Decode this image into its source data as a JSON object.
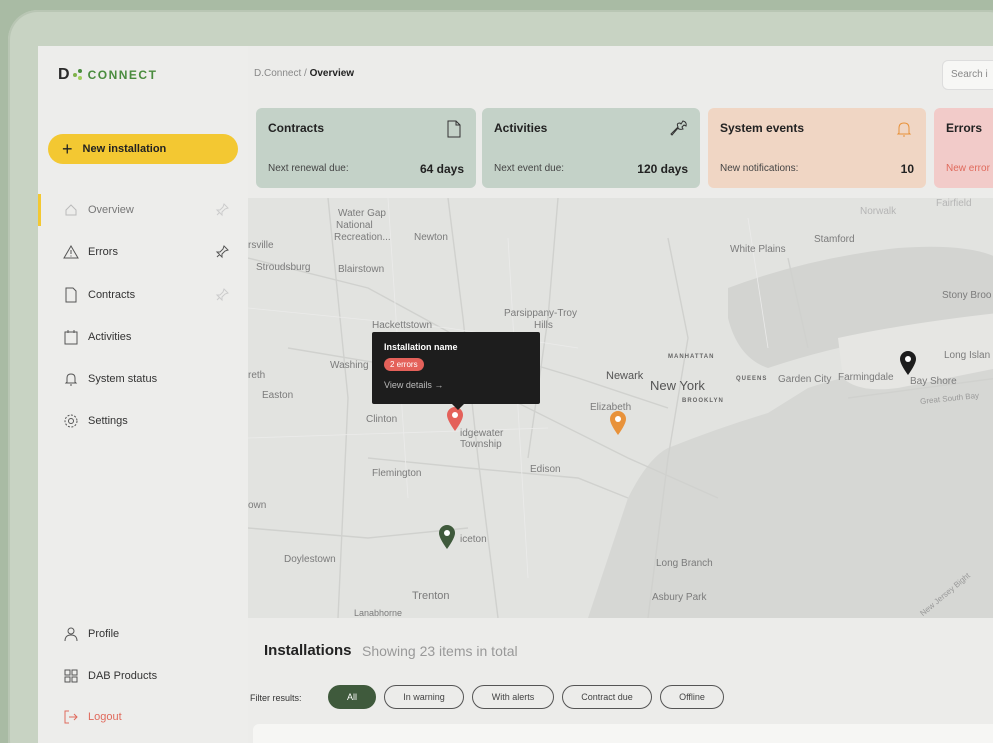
{
  "logo": {
    "d": "D",
    "text": "CONNECT"
  },
  "breadcrumb": {
    "root": "D.Connect",
    "sep": "/",
    "current": "Overview"
  },
  "search": {
    "placeholder": "Search i"
  },
  "sidebar": {
    "new_button": "New installation",
    "items": [
      {
        "label": "Overview",
        "icon": "home-icon",
        "active": true
      },
      {
        "label": "Errors",
        "icon": "warning-icon"
      },
      {
        "label": "Contracts",
        "icon": "document-icon"
      },
      {
        "label": "Activities",
        "icon": "calendar-icon"
      },
      {
        "label": "System status",
        "icon": "bell-icon"
      },
      {
        "label": "Settings",
        "icon": "gear-icon"
      }
    ],
    "bottom": [
      {
        "label": "Profile",
        "icon": "user-icon"
      },
      {
        "label": "DAB Products",
        "icon": "grid-icon"
      },
      {
        "label": "Logout",
        "icon": "logout-icon"
      }
    ]
  },
  "cards": [
    {
      "title": "Contracts",
      "sub": "Next renewal due:",
      "value": "64 days",
      "icon": "document-icon",
      "color": "#c4d2c8"
    },
    {
      "title": "Activities",
      "sub": "Next event due:",
      "value": "120 days",
      "icon": "wrench-icon",
      "color": "#c4d2c8"
    },
    {
      "title": "System events",
      "sub": "New notifications:",
      "value": "10",
      "icon": "bell-icon",
      "color": "#f0d6c4"
    },
    {
      "title": "Errors",
      "sub": "New error",
      "value": "",
      "icon": "",
      "color": "#f2cbc9"
    }
  ],
  "map": {
    "labels": [
      {
        "text": "Water Gap",
        "cls": ""
      },
      {
        "text": "National",
        "cls": ""
      },
      {
        "text": "Recreation...",
        "cls": ""
      },
      {
        "text": "Newton",
        "cls": ""
      },
      {
        "text": "rsville",
        "cls": ""
      },
      {
        "text": "Stroudsburg",
        "cls": ""
      },
      {
        "text": "Blairstown",
        "cls": ""
      },
      {
        "text": "White Plains",
        "cls": ""
      },
      {
        "text": "Stamford",
        "cls": ""
      },
      {
        "text": "Norwalk",
        "cls": ""
      },
      {
        "text": "Fairfield",
        "cls": ""
      },
      {
        "text": "Stony Broo",
        "cls": ""
      },
      {
        "text": "Hackettstown",
        "cls": ""
      },
      {
        "text": "Parsippany-Troy",
        "cls": ""
      },
      {
        "text": "Hills",
        "cls": ""
      },
      {
        "text": "MANHATTAN",
        "cls": "tiny"
      },
      {
        "text": "Long Islan",
        "cls": ""
      },
      {
        "text": "reth",
        "cls": ""
      },
      {
        "text": "Washing",
        "cls": ""
      },
      {
        "text": "Newark",
        "cls": ""
      },
      {
        "text": "New York",
        "cls": "big"
      },
      {
        "text": "QUEENS",
        "cls": "tiny"
      },
      {
        "text": "Garden City",
        "cls": ""
      },
      {
        "text": "Farmingdale",
        "cls": ""
      },
      {
        "text": "Bay Shore",
        "cls": ""
      },
      {
        "text": "Great South Bay",
        "cls": ""
      },
      {
        "text": "Easton",
        "cls": ""
      },
      {
        "text": "BROOKLYN",
        "cls": "tiny"
      },
      {
        "text": "Elizabeth",
        "cls": ""
      },
      {
        "text": "Clinton",
        "cls": ""
      },
      {
        "text": "idgewater",
        "cls": ""
      },
      {
        "text": "Township",
        "cls": ""
      },
      {
        "text": "Edison",
        "cls": ""
      },
      {
        "text": "Flemington",
        "cls": ""
      },
      {
        "text": "own",
        "cls": ""
      },
      {
        "text": "iceton",
        "cls": ""
      },
      {
        "text": "Doylestown",
        "cls": ""
      },
      {
        "text": "Long Branch",
        "cls": ""
      },
      {
        "text": "Trenton",
        "cls": ""
      },
      {
        "text": "Asbury Park",
        "cls": ""
      },
      {
        "text": "New Jersey Bight",
        "cls": ""
      },
      {
        "text": "Lanabhorne",
        "cls": ""
      }
    ],
    "tooltip": {
      "title": "Installation name",
      "badge": "2 errors",
      "link": "View details →"
    },
    "marker_colors": {
      "error": "#e4615a",
      "warning": "#e8923a",
      "ok": "#3f5a3c",
      "default": "#1d1d1d"
    }
  },
  "installations": {
    "title": "Installations",
    "count_text": "Showing 23 items in total",
    "filter_label": "Filter results:",
    "filters": [
      "All",
      "In warning",
      "With alerts",
      "Contract due",
      "Offline"
    ]
  }
}
